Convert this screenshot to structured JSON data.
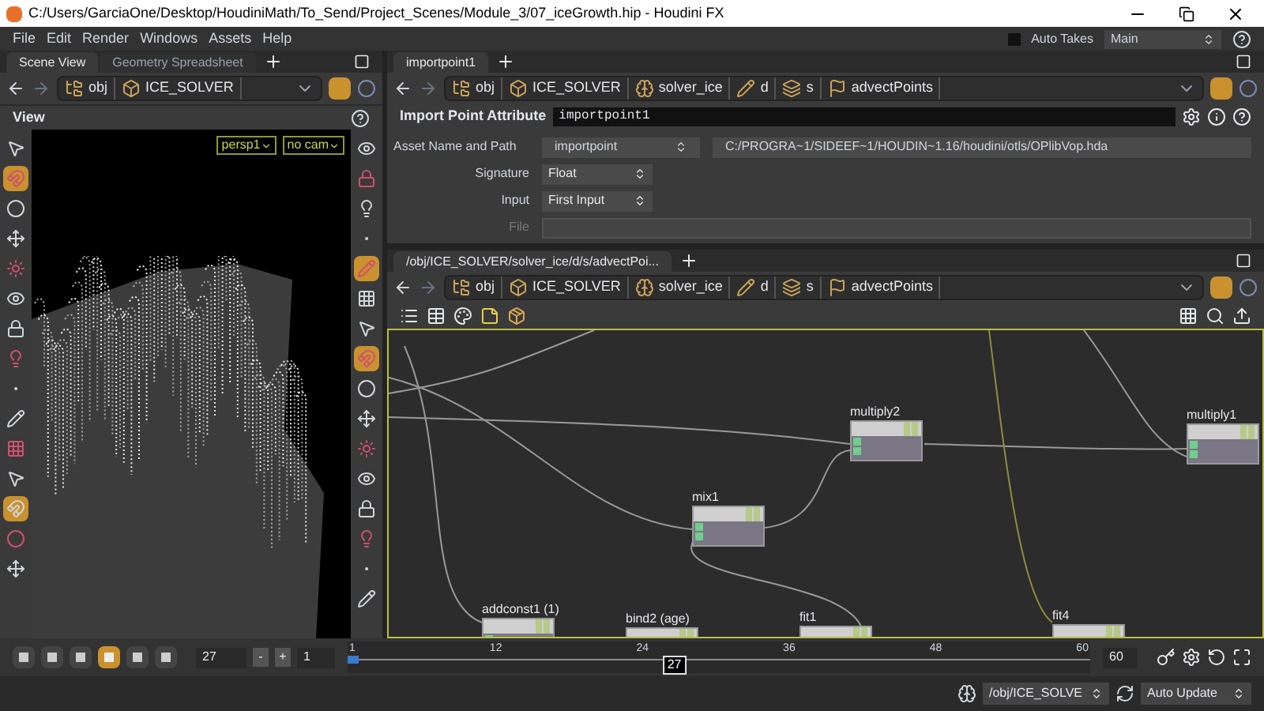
{
  "window": {
    "title": "C:/Users/GarciaOne/Desktop/HoudiniMath/To_Send/Project_Scenes/Module_3/07_iceGrowth.hip - Houdini FX"
  },
  "menu": [
    "File",
    "Edit",
    "Render",
    "Windows",
    "Assets",
    "Help"
  ],
  "takes": {
    "auto_takes": {
      "label": "Auto Takes",
      "checked": false
    },
    "take": "Main"
  },
  "scene_pane": {
    "tabs": [
      {
        "label": "Scene View",
        "selected": true
      },
      {
        "label": "Geometry Spreadsheet",
        "selected": false
      }
    ],
    "path": [
      "obj",
      "ICE_SOLVER"
    ],
    "header": "View",
    "camera": "persp1",
    "camera_mode": "no cam",
    "tools_left": [
      {
        "selected": false
      },
      {
        "selected": true
      },
      {
        "selected": false
      },
      {
        "selected": false
      },
      {
        "selected": false
      },
      {
        "selected": false
      },
      {
        "selected": false
      },
      {
        "selected": false
      },
      {
        "selected": false
      },
      {
        "selected": false
      },
      {
        "selected": false
      },
      {
        "selected": false
      },
      {
        "selected": true
      },
      {
        "selected": false
      },
      {
        "selected": false
      }
    ],
    "tools_right": [
      {
        "selected": false
      },
      {
        "selected": false
      },
      {
        "selected": false
      },
      {
        "selected": false
      },
      {
        "selected": true
      },
      {
        "selected": false
      },
      {
        "selected": false
      },
      {
        "selected": true
      },
      {
        "selected": false
      },
      {
        "selected": false
      },
      {
        "selected": false
      },
      {
        "selected": false
      },
      {
        "selected": false
      },
      {
        "selected": false
      },
      {
        "selected": false
      },
      {
        "selected": false
      }
    ]
  },
  "params_pane": {
    "tabs": [
      {
        "label": "importpoint1",
        "selected": true
      }
    ],
    "path": [
      "obj",
      "ICE_SOLVER",
      "solver_ice",
      "d",
      "s",
      "advectPoints"
    ],
    "node_type": "Import Point Attribute",
    "node_name": "importpoint1",
    "fields": [
      {
        "kind": "asset",
        "label": "Asset Name and Path",
        "value": "importpoint",
        "path": "C:/PROGRA~1/SIDEEF~1/HOUDIN~1.16/houdini/otls/OPlibVop.hda",
        "disabled": false
      },
      {
        "kind": "menu",
        "label": "Signature",
        "value": "Float",
        "disabled": false
      },
      {
        "kind": "menu",
        "label": "Input",
        "value": "First Input",
        "disabled": false
      },
      {
        "kind": "file",
        "label": "File",
        "disabled": true
      }
    ]
  },
  "network_pane": {
    "tabs": [
      {
        "label": "/obj/ICE_SOLVER/solver_ice/d/s/advectPoi...",
        "selected": true
      }
    ],
    "path": [
      "obj",
      "ICE_SOLVER",
      "solver_ice",
      "d",
      "s",
      "advectPoints"
    ],
    "nodes": [
      {
        "name": "multiply2"
      },
      {
        "name": "multiply1"
      },
      {
        "name": "mix1"
      },
      {
        "name": "addconst1 (1)"
      },
      {
        "name": "bind2 (age)"
      },
      {
        "name": "fit1"
      },
      {
        "name": "fit4"
      }
    ]
  },
  "timeline": {
    "frame": "27",
    "step_buttons": [
      "-",
      "+"
    ],
    "step": "1",
    "ticks": [
      "1",
      "12",
      "24",
      "36",
      "48",
      "60"
    ],
    "current": "27",
    "level": 0.44,
    "end": "60"
  },
  "status": {
    "path": "/obj/ICE_SOLVE",
    "update_mode": "Auto Update"
  }
}
